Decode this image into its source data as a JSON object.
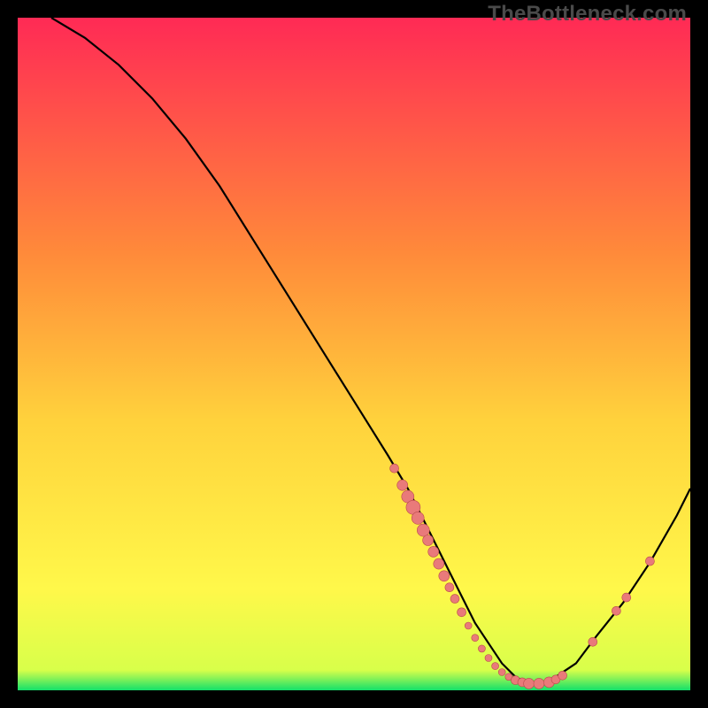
{
  "watermark": "TheBottleneck.com",
  "colors": {
    "background": "#000000",
    "grad_top": "#ff2a55",
    "grad_mid1": "#ff6a3c",
    "grad_mid2": "#ffd23c",
    "grad_mid3": "#fff84a",
    "grad_bottom": "#13e06a",
    "curve": "#000000",
    "marker_fill": "#e97a7a",
    "marker_stroke": "#b94b4b"
  },
  "chart_data": {
    "type": "line",
    "title": "",
    "xlabel": "",
    "ylabel": "",
    "xlim": [
      0,
      100
    ],
    "ylim": [
      0,
      100
    ],
    "curve": {
      "x": [
        5,
        10,
        15,
        20,
        25,
        30,
        35,
        40,
        45,
        50,
        55,
        58,
        60,
        62,
        64,
        66,
        68,
        70,
        72,
        74,
        76,
        78,
        80,
        83,
        86,
        90,
        94,
        98,
        100
      ],
      "y": [
        100,
        97,
        93,
        88,
        82,
        75,
        67,
        59,
        51,
        43,
        35,
        30,
        26,
        22,
        18,
        14,
        10,
        7,
        4,
        2,
        1,
        1,
        2,
        4,
        8,
        13,
        19,
        26,
        30
      ]
    },
    "markers": [
      {
        "x": 56.0,
        "y": 33.0,
        "r": 5
      },
      {
        "x": 57.2,
        "y": 30.5,
        "r": 6
      },
      {
        "x": 58.0,
        "y": 28.8,
        "r": 7
      },
      {
        "x": 58.8,
        "y": 27.2,
        "r": 8
      },
      {
        "x": 59.5,
        "y": 25.6,
        "r": 7
      },
      {
        "x": 60.3,
        "y": 23.8,
        "r": 7
      },
      {
        "x": 61.0,
        "y": 22.3,
        "r": 6
      },
      {
        "x": 61.8,
        "y": 20.6,
        "r": 6
      },
      {
        "x": 62.6,
        "y": 18.8,
        "r": 6
      },
      {
        "x": 63.4,
        "y": 17.0,
        "r": 6
      },
      {
        "x": 64.2,
        "y": 15.3,
        "r": 5
      },
      {
        "x": 65.0,
        "y": 13.6,
        "r": 5
      },
      {
        "x": 66.0,
        "y": 11.6,
        "r": 5
      },
      {
        "x": 67.0,
        "y": 9.6,
        "r": 4
      },
      {
        "x": 68.0,
        "y": 7.8,
        "r": 4
      },
      {
        "x": 69.0,
        "y": 6.2,
        "r": 4
      },
      {
        "x": 70.0,
        "y": 4.8,
        "r": 4
      },
      {
        "x": 71.0,
        "y": 3.6,
        "r": 4
      },
      {
        "x": 72.0,
        "y": 2.7,
        "r": 4
      },
      {
        "x": 73.0,
        "y": 2.0,
        "r": 4
      },
      {
        "x": 74.0,
        "y": 1.5,
        "r": 5
      },
      {
        "x": 75.0,
        "y": 1.2,
        "r": 5
      },
      {
        "x": 76.0,
        "y": 1.0,
        "r": 6
      },
      {
        "x": 77.5,
        "y": 1.0,
        "r": 6
      },
      {
        "x": 79.0,
        "y": 1.2,
        "r": 6
      },
      {
        "x": 80.0,
        "y": 1.6,
        "r": 5
      },
      {
        "x": 81.0,
        "y": 2.2,
        "r": 5
      },
      {
        "x": 85.5,
        "y": 7.2,
        "r": 5
      },
      {
        "x": 89.0,
        "y": 11.8,
        "r": 5
      },
      {
        "x": 90.5,
        "y": 13.8,
        "r": 5
      },
      {
        "x": 94.0,
        "y": 19.2,
        "r": 5
      }
    ]
  }
}
